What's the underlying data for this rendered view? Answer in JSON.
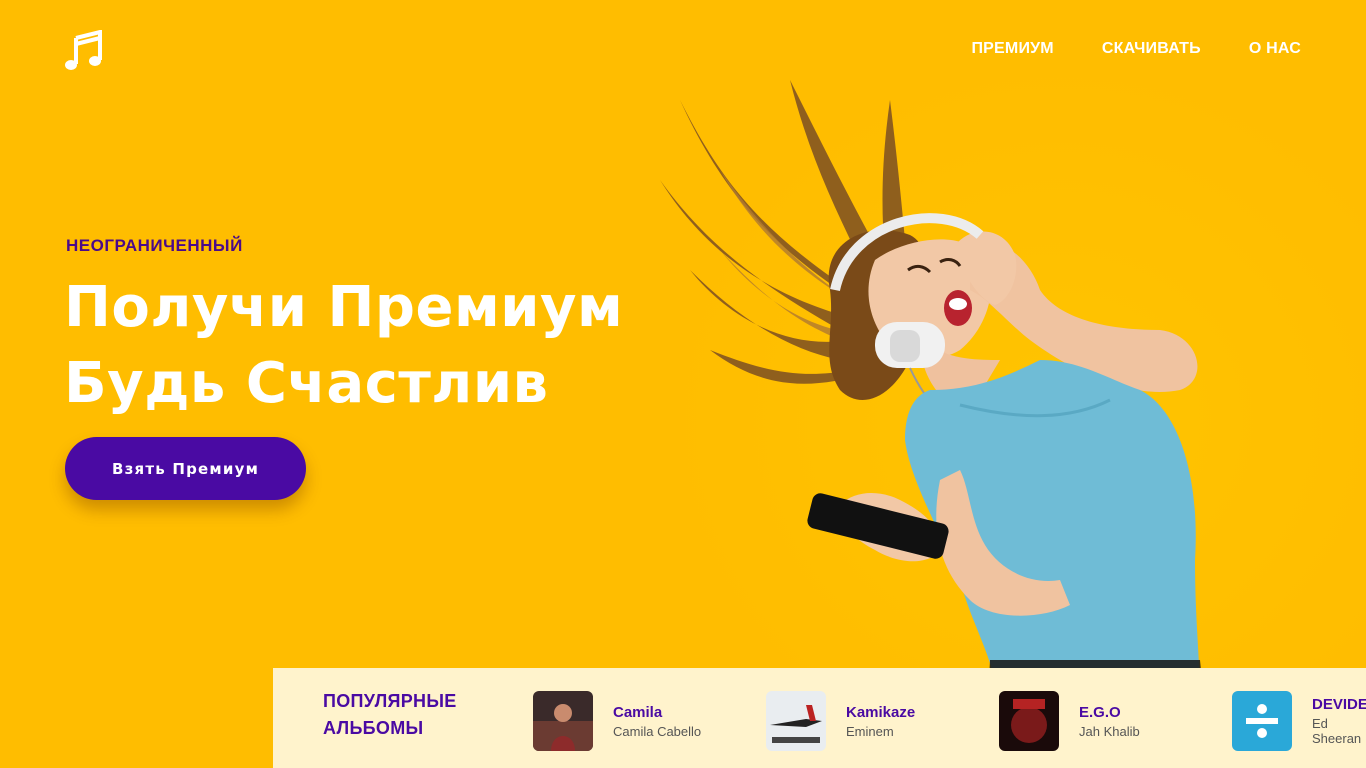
{
  "colors": {
    "background": "#ffbd00",
    "accent": "#4a0aa3",
    "bar_background": "#fff3cc"
  },
  "header": {
    "logo_icon": "music-note-icon",
    "nav": [
      {
        "label": "ПРЕМИУМ"
      },
      {
        "label": "СКАЧИВАТЬ"
      },
      {
        "label": "О НАС"
      }
    ]
  },
  "hero": {
    "eyebrow": "НЕОГРАНИЧЕННЫЙ",
    "title_line1": "Получи Премиум",
    "title_line2": "Будь Счастлив",
    "cta_label": "Взять Премиум"
  },
  "albums": {
    "heading_line1": "ПОПУЛЯРНЫЕ",
    "heading_line2": "АЛЬБОМЫ",
    "items": [
      {
        "title": "Camila",
        "artist": "Camila Cabello"
      },
      {
        "title": "Kamikaze",
        "artist": "Eminem"
      },
      {
        "title": "E.G.O",
        "artist": "Jah Khalib"
      },
      {
        "title": "DEVIDE",
        "artist": "Ed Sheeran"
      }
    ]
  }
}
